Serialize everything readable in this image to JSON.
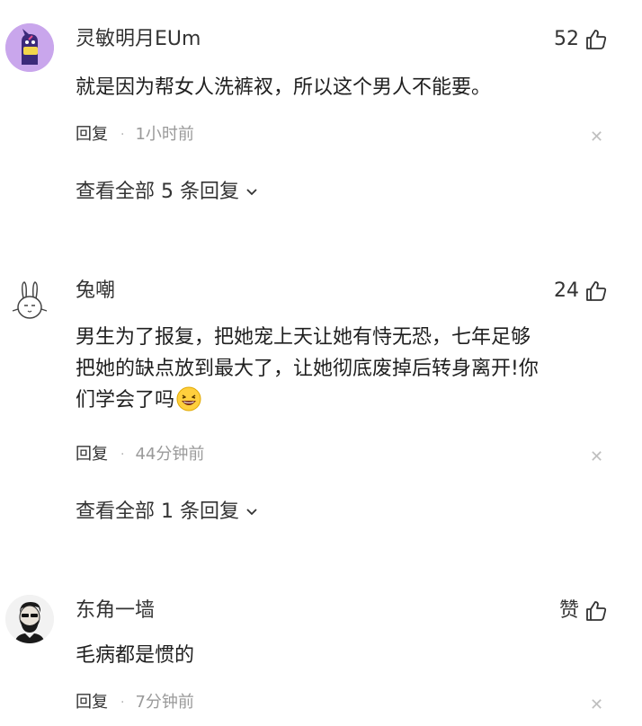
{
  "comments": [
    {
      "username": "灵敏明月EUm",
      "like_text": "52",
      "text": "就是因为帮女人洗裤衩，所以这个男人不能要。",
      "reply_label": "回复",
      "time": "1小时前",
      "view_replies": "查看全部 5 条回复",
      "avatar_icon": "purple-cartoon-avatar"
    },
    {
      "username": "兔嘲",
      "like_text": "24",
      "text_lines": [
        "男生为了报复，把她宠上天让她有恃无恐，七年足够",
        "把她的缺点放到最大了，让她彻底废掉后转身离开!你",
        "们学会了吗"
      ],
      "emoji": "laughing-emoji",
      "reply_label": "回复",
      "time": "44分钟前",
      "view_replies": "查看全部 1 条回复",
      "avatar_icon": "rabbit-sketch-avatar"
    },
    {
      "username": "东角一墙",
      "like_text": "赞",
      "text": "毛病都是惯的",
      "reply_label": "回复",
      "time": "7分钟前",
      "avatar_icon": "bearded-man-avatar"
    }
  ],
  "colors": {
    "username": "#333333",
    "time": "#9a9a9a",
    "close": "#bfbfbf",
    "avatar1_bg": "#c9a6ec",
    "avatar1_figure": "#3b2a7a",
    "emoji_yellow": "#ffcf3d"
  }
}
